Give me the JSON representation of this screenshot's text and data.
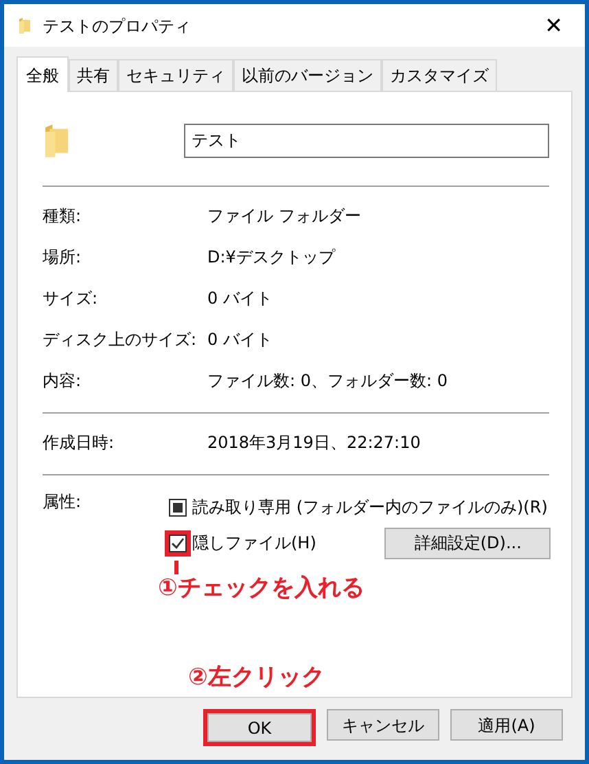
{
  "window": {
    "title": "テストのプロパティ",
    "close": "✕"
  },
  "tabs": [
    {
      "label": "全般",
      "selected": true
    },
    {
      "label": "共有",
      "selected": false
    },
    {
      "label": "セキュリティ",
      "selected": false
    },
    {
      "label": "以前のバージョン",
      "selected": false
    },
    {
      "label": "カスタマイズ",
      "selected": false
    }
  ],
  "name_field": {
    "value": "テスト"
  },
  "sections": [
    [
      {
        "label": "種類:",
        "value": "ファイル フォルダー"
      },
      {
        "label": "場所:",
        "value": "D:¥デスクトップ"
      },
      {
        "label": "サイズ:",
        "value": "0 バイト"
      },
      {
        "label": "ディスク上のサイズ:",
        "value": "0 バイト"
      },
      {
        "label": "内容:",
        "value": "ファイル数: 0、フォルダー数: 0"
      }
    ],
    [
      {
        "label": "作成日時:",
        "value": "2018年3月19日、22:27:10"
      }
    ]
  ],
  "attributes": {
    "label": "属性:",
    "options": [
      {
        "label": "読み取り専用 (フォルダー内のファイルのみ)(R)",
        "indeterminate": true,
        "highlighted": false
      },
      {
        "label": "隠しファイル(H)",
        "checked": true,
        "highlighted": true
      }
    ],
    "advanced_button": "詳細設定(D)..."
  },
  "annotations": [
    "①チェックを入れる",
    "②左クリック"
  ],
  "buttons": [
    {
      "label": "OK",
      "highlighted": true
    },
    {
      "label": "キャンセル",
      "highlighted": false
    },
    {
      "label": "適用(A)",
      "highlighted": false
    }
  ]
}
